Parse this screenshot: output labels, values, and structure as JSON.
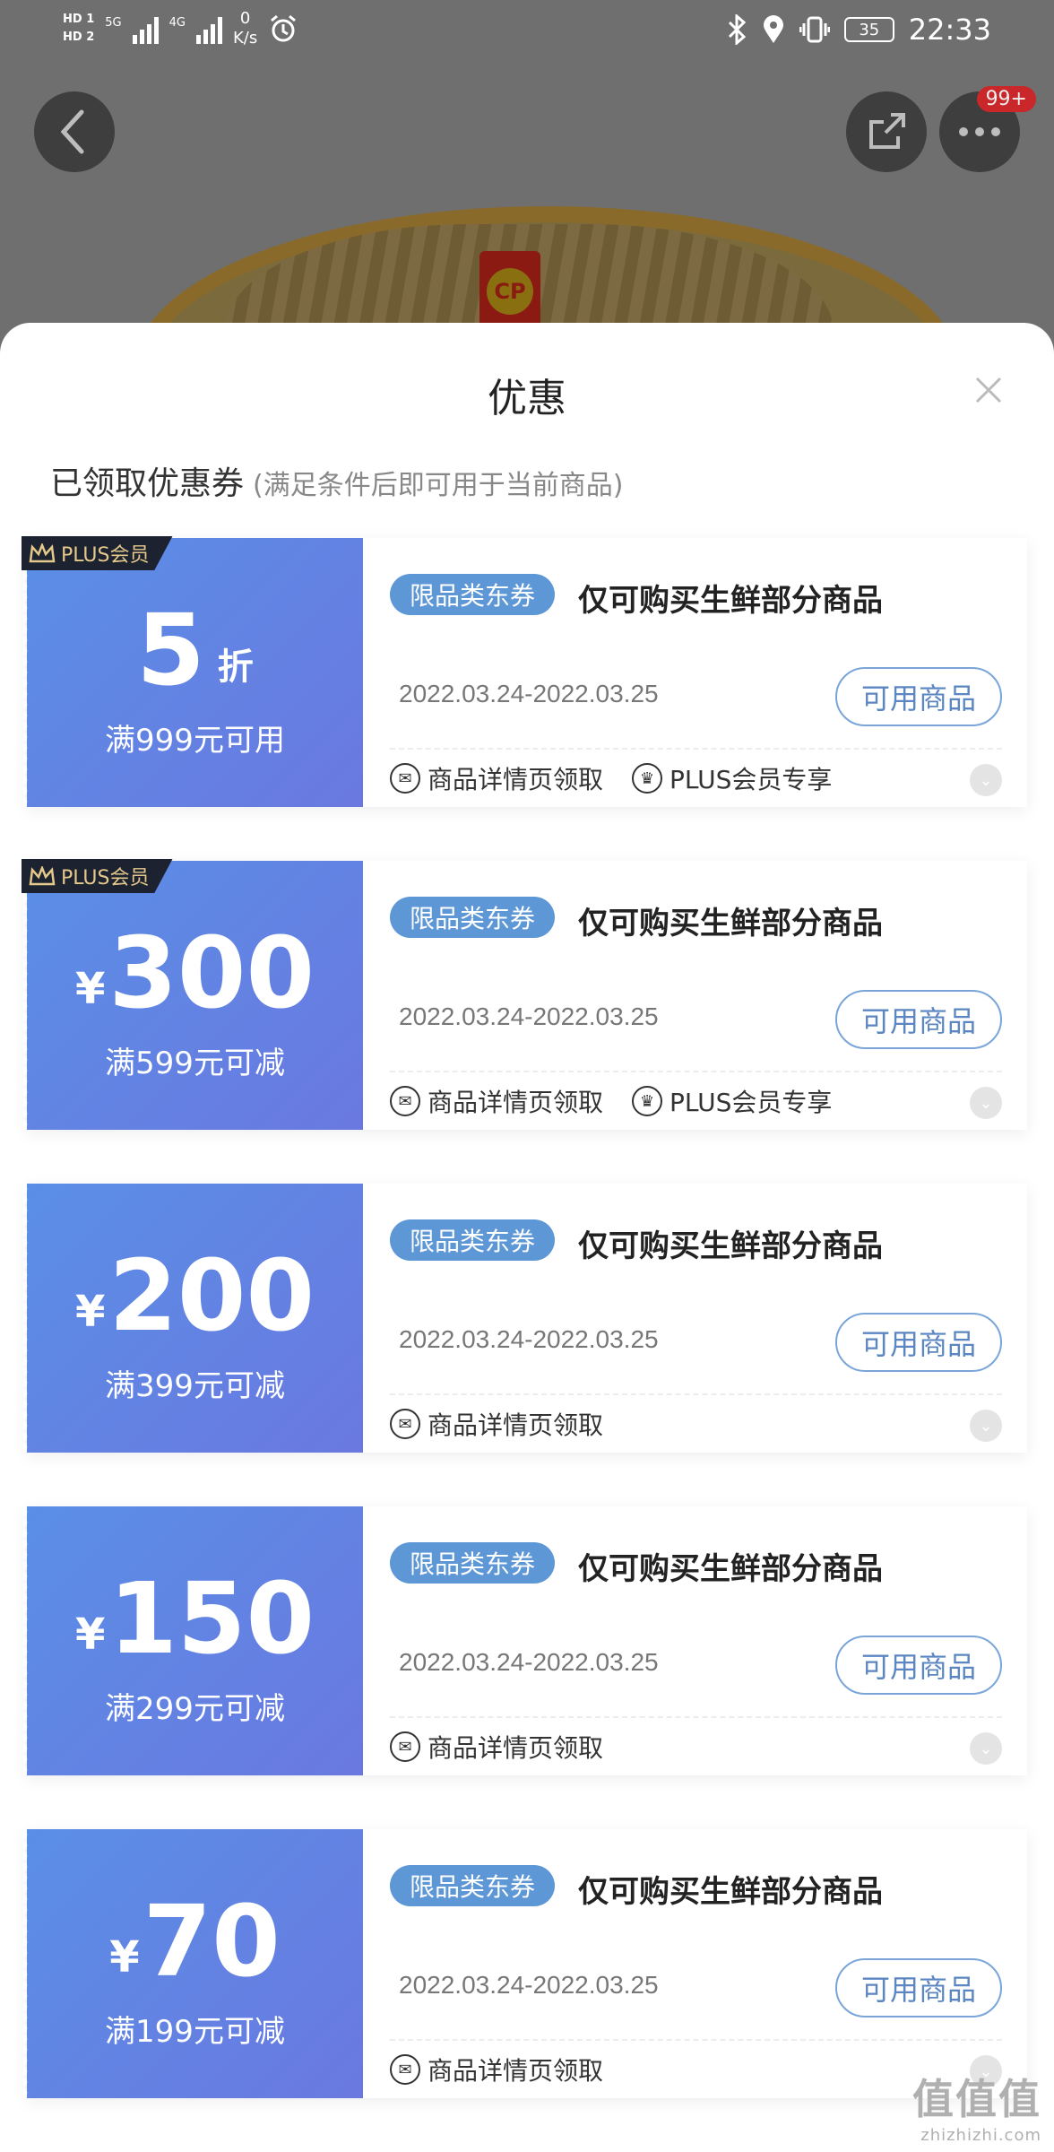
{
  "status_bar": {
    "hd1": "HD 1",
    "hd2": "HD 2",
    "net1": "5G",
    "net2": "4G",
    "speed_value": "0",
    "speed_unit": "K/s",
    "battery": "35",
    "time": "22:33"
  },
  "nav": {
    "more_badge": "99+"
  },
  "product_image": {
    "logo_text": "CP"
  },
  "sheet": {
    "title": "优惠",
    "section_label": "已领取优惠券",
    "section_note": "(满足条件后即可用于当前商品)"
  },
  "coupons": [
    {
      "plus_tag": "PLUS会员",
      "currency": "",
      "amount": "5",
      "unit": "折",
      "condition": "满999元可用",
      "type_badge": "限品类东券",
      "scope": "仅可购买生鲜部分商品",
      "dates": "2022.03.24-2022.03.25",
      "button": "可用商品",
      "tag1": "商品详情页领取",
      "tag2": "PLUS会员专享"
    },
    {
      "plus_tag": "PLUS会员",
      "currency": "¥",
      "amount": "300",
      "unit": "",
      "condition": "满599元可减",
      "type_badge": "限品类东券",
      "scope": "仅可购买生鲜部分商品",
      "dates": "2022.03.24-2022.03.25",
      "button": "可用商品",
      "tag1": "商品详情页领取",
      "tag2": "PLUS会员专享"
    },
    {
      "currency": "¥",
      "amount": "200",
      "unit": "",
      "condition": "满399元可减",
      "type_badge": "限品类东券",
      "scope": "仅可购买生鲜部分商品",
      "dates": "2022.03.24-2022.03.25",
      "button": "可用商品",
      "tag1": "商品详情页领取"
    },
    {
      "currency": "¥",
      "amount": "150",
      "unit": "",
      "condition": "满299元可减",
      "type_badge": "限品类东券",
      "scope": "仅可购买生鲜部分商品",
      "dates": "2022.03.24-2022.03.25",
      "button": "可用商品",
      "tag1": "商品详情页领取"
    },
    {
      "currency": "¥",
      "amount": "70",
      "unit": "",
      "condition": "满199元可减",
      "type_badge": "限品类东券",
      "scope": "仅可购买生鲜部分商品",
      "dates": "2022.03.24-2022.03.25",
      "button": "可用商品",
      "tag1": "商品详情页领取"
    }
  ],
  "watermark": {
    "text": "值值值",
    "sub": "zhizhizhi.com"
  },
  "colors": {
    "coupon_gradient_start": "#5a8fe6",
    "coupon_gradient_end": "#6a78e0",
    "badge_blue": "#5d97d6",
    "plus_tag_bg": "#1c2230",
    "plus_tag_gold": "#e4c98a",
    "notification_red": "#c9272a"
  }
}
